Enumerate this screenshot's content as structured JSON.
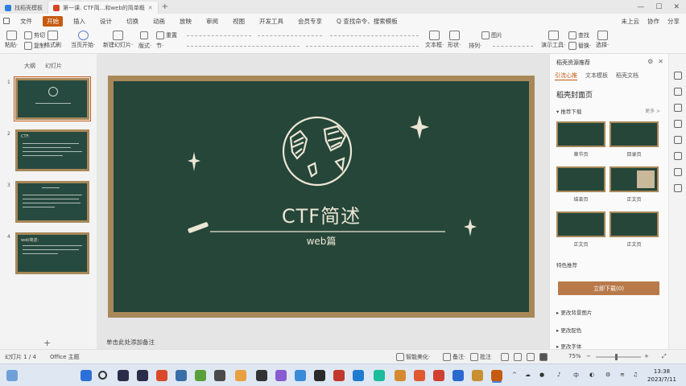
{
  "window": {
    "tabs": [
      {
        "label": "找稻壳模板",
        "active": false
      },
      {
        "label": "第一课. CTF简...和web的简单概",
        "active": true
      }
    ]
  },
  "menu": {
    "items": [
      "文件",
      "开始",
      "插入",
      "设计",
      "切换",
      "动画",
      "放映",
      "审阅",
      "视图",
      "开发工具",
      "会员专享",
      "Q 查找命令、搜索模板"
    ],
    "active": "开始",
    "right": [
      "未上云",
      "协作",
      "分享"
    ]
  },
  "ribbon": {
    "paste": "粘贴·",
    "cut": "剪切",
    "copy": "复制",
    "format_painter": "格式刷",
    "from_current": "当页开始·",
    "new_slide": "新建幻灯片·",
    "layout": "版式·",
    "section": "节·",
    "reset": "重置",
    "textbox": "文本框·",
    "shape": "形状·",
    "arrange": "排列·",
    "image": "图片",
    "presenter": "演示工具·",
    "find": "查找",
    "replace": "替换·",
    "select": "选择·"
  },
  "left_panel": {
    "tabs": [
      "大纲",
      "幻灯片"
    ],
    "thumbs": [
      "1",
      "2",
      "3",
      "4"
    ],
    "thumb2_title": "CTF:",
    "thumb4_title": "web简述:"
  },
  "slide": {
    "title": "CTF简述",
    "subtitle": "web篇",
    "colors": {
      "board": "#254639",
      "frame": "#a88859",
      "chalk": "#ece6d4"
    }
  },
  "notes_placeholder": "单击此处添加备注",
  "right_panel": {
    "header": "稻壳资源推荐",
    "tabs": [
      "引流心推",
      "文本模板",
      "稻壳文档"
    ],
    "title": "稻壳封面页",
    "section1": "▾ 推荐下载",
    "more": "更多 >",
    "templates": [
      {
        "label": "章节页"
      },
      {
        "label": "目录页"
      },
      {
        "label": "结束页"
      },
      {
        "label": "正文页"
      },
      {
        "label": "正文页"
      },
      {
        "label": "正文页"
      }
    ],
    "section2": "特色推荐",
    "download_button": "立即下载(0)",
    "links": [
      "▸ 更改背景图片",
      "▸ 更改配色",
      "▸ 更改字体"
    ]
  },
  "status": {
    "slide_counter": "幻灯片 1 / 4",
    "theme": "Office 主题",
    "beautify": "智能美化·",
    "notes": "备注·",
    "comments": "批注",
    "zoom": "75%",
    "zoom_fraction": 0.42
  },
  "taskbar": {
    "time": "13:38",
    "date": "2023/7/11",
    "ime": "中"
  }
}
